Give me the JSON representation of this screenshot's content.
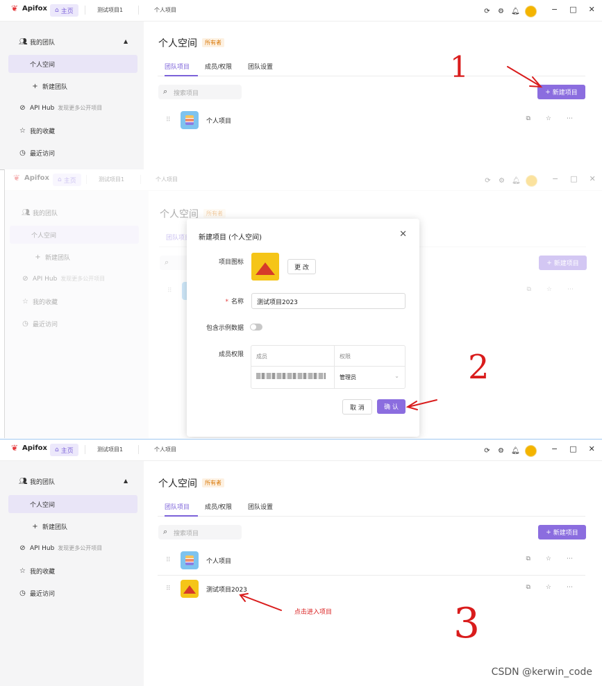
{
  "app": {
    "logo_text": "Apifox",
    "home_tab": "主页",
    "open_tabs": [
      "测试项目1",
      "个人项目"
    ]
  },
  "sidebar": {
    "team_group": "我的团队",
    "personal_space": "个人空间",
    "new_team": "新建团队",
    "api_hub": "API Hub",
    "api_hub_hint": "发现更多公开项目",
    "favorites": "我的收藏",
    "recent": "最近访问"
  },
  "main": {
    "space_title": "个人空间",
    "owner_badge": "所有者",
    "tabs": [
      "团队项目",
      "成员/权限",
      "团队设置"
    ],
    "search_placeholder": "搜索项目",
    "new_project_button": "新建项目",
    "projects_before": [
      "个人项目"
    ],
    "projects_after": [
      "个人项目",
      "测试项目2023"
    ]
  },
  "modal": {
    "title": "新建项目 (个人空间)",
    "icon_label": "项目图标",
    "change_button": "更 改",
    "name_label": "名称",
    "name_value": "测试项目2023",
    "sample_data_label": "包含示例数据",
    "sample_data_enabled": false,
    "member_label": "成员权限",
    "table_headers": [
      "成员",
      "权限"
    ],
    "member_role": "管理员",
    "cancel_button": "取 消",
    "ok_button": "确 认"
  },
  "annotations": {
    "step_numbers": [
      "1",
      "2",
      "3"
    ],
    "note": "点击进入项目",
    "watermark": "CSDN @kerwin_code",
    "color": "#d91c1c"
  },
  "colors": {
    "accent": "#8b6ddf",
    "sidebar_bg": "#f5f5f6",
    "owner_badge": "#d97706"
  }
}
